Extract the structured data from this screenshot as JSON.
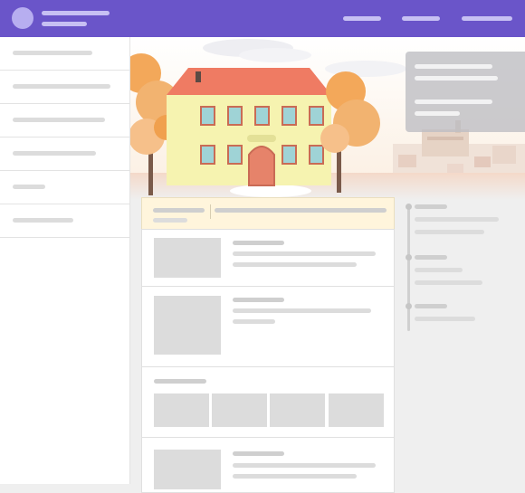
{
  "header": {
    "avatar_icon": "user-avatar-icon",
    "brand_color": "#6a55c9",
    "nav_items": [
      "nav-item-1",
      "nav-item-2",
      "nav-item-3"
    ]
  },
  "sidebar": {
    "items": [
      "sidebar-item-1",
      "sidebar-item-2",
      "sidebar-item-3",
      "sidebar-item-4",
      "sidebar-item-5",
      "sidebar-item-6"
    ]
  },
  "hero": {
    "illustration": "autumn-manor-house-illustration",
    "palette": {
      "sky": "#fdf3ea",
      "roof": "#ef7b63",
      "wall": "#f6f3b0",
      "tree": "#f3a85a",
      "path": "#ffffff"
    }
  },
  "feed": {
    "highlight_color": "#fff5dc",
    "posts": [
      "post-1",
      "post-2",
      "post-3",
      "post-4"
    ]
  },
  "timeline": {
    "entries": [
      "timeline-entry-1",
      "timeline-entry-2",
      "timeline-entry-3"
    ]
  }
}
